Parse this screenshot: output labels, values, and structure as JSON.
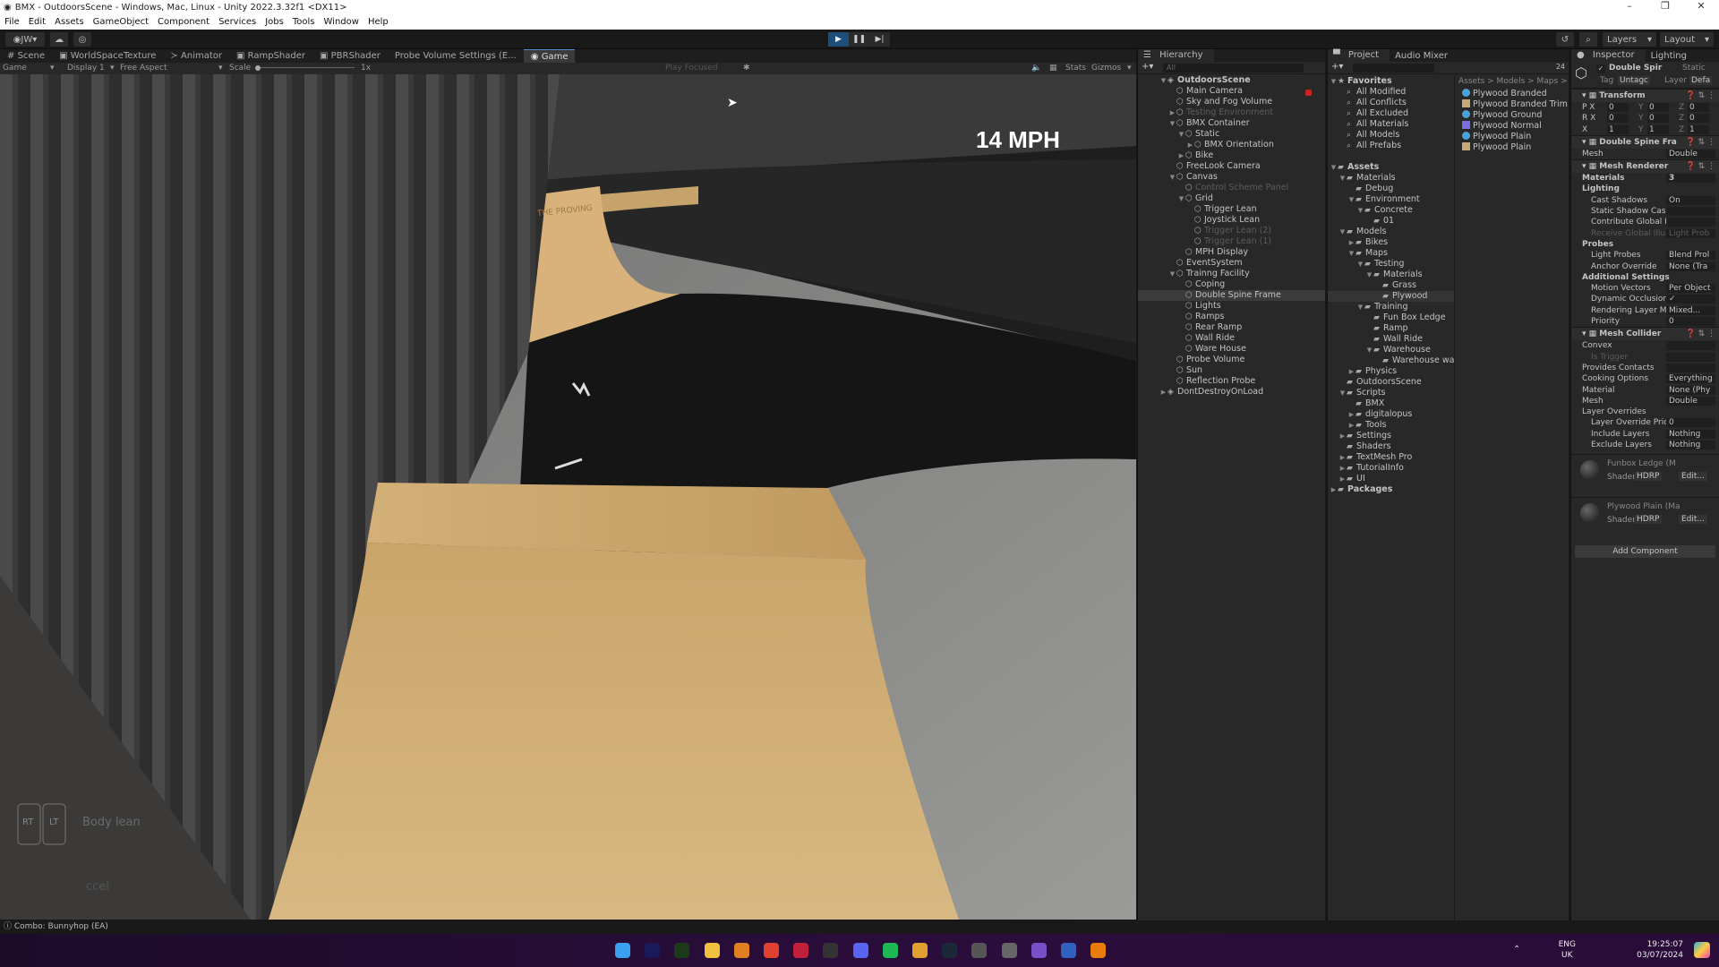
{
  "window": {
    "title": "BMX - OutdoorsScene - Windows, Mac, Linux - Unity 2022.3.32f1 <DX11>"
  },
  "menu": [
    "File",
    "Edit",
    "Assets",
    "GameObject",
    "Component",
    "Services",
    "Jobs",
    "Tools",
    "Window",
    "Help"
  ],
  "toolbar": {
    "account": "JW",
    "layers": "Layers",
    "layout": "Layout"
  },
  "tabs": [
    {
      "label": "Scene"
    },
    {
      "label": "WorldSpaceTexture"
    },
    {
      "label": "Animator"
    },
    {
      "label": "RampShader"
    },
    {
      "label": "PBRShader"
    },
    {
      "label": "Probe Volume Settings (E..."
    },
    {
      "label": "Game",
      "active": true
    }
  ],
  "gamebar": {
    "mode": "Game",
    "display": "Display 1",
    "aspect": "Free Aspect",
    "scale_label": "Scale",
    "scale_value": "1x",
    "play_focused": "Play Focused",
    "stats": "Stats",
    "gizmos": "Gizmos"
  },
  "game": {
    "speed": "14 MPH",
    "hint_rt": "RT",
    "hint_lt": "LT",
    "hint_text": "Body lean",
    "hint_text2": "ccel",
    "ramp_brand": "THE PROVING"
  },
  "hierarchy": {
    "title": "Hierarchy",
    "search": "All",
    "items": [
      {
        "label": "OutdoorsScene",
        "depth": 0,
        "arrow": "down",
        "icon": "scene",
        "bold": true
      },
      {
        "label": "Main Camera",
        "depth": 1
      },
      {
        "label": "Sky and Fog Volume",
        "depth": 1
      },
      {
        "label": "Testing Environment",
        "depth": 1,
        "arrow": "right",
        "dim": true
      },
      {
        "label": "BMX Container",
        "depth": 1,
        "arrow": "down"
      },
      {
        "label": "Static",
        "depth": 2,
        "arrow": "down"
      },
      {
        "label": "BMX Orientation",
        "depth": 3,
        "arrow": "right"
      },
      {
        "label": "Bike",
        "depth": 2,
        "arrow": "right"
      },
      {
        "label": "FreeLook Camera",
        "depth": 1
      },
      {
        "label": "Canvas",
        "depth": 1,
        "arrow": "down"
      },
      {
        "label": "Control Scheme Panel",
        "depth": 2,
        "dim": true
      },
      {
        "label": "Grid",
        "depth": 2,
        "arrow": "down"
      },
      {
        "label": "Trigger Lean",
        "depth": 3
      },
      {
        "label": "Joystick Lean",
        "depth": 3
      },
      {
        "label": "Trigger Lean (2)",
        "depth": 3,
        "dim": true
      },
      {
        "label": "Trigger Lean (1)",
        "depth": 3,
        "dim": true
      },
      {
        "label": "MPH Display",
        "depth": 2
      },
      {
        "label": "EventSystem",
        "depth": 1
      },
      {
        "label": "Trainng Facility",
        "depth": 1,
        "arrow": "down"
      },
      {
        "label": "Coping",
        "depth": 2
      },
      {
        "label": "Double Spine Frame",
        "depth": 2,
        "selected": true
      },
      {
        "label": "Lights",
        "depth": 2
      },
      {
        "label": "Ramps",
        "depth": 2
      },
      {
        "label": "Rear Ramp",
        "depth": 2
      },
      {
        "label": "Wall Ride",
        "depth": 2
      },
      {
        "label": "Ware House",
        "depth": 2
      },
      {
        "label": "Probe Volume",
        "depth": 1
      },
      {
        "label": "Sun",
        "depth": 1
      },
      {
        "label": "Reflection Probe",
        "depth": 1
      },
      {
        "label": "DontDestroyOnLoad",
        "depth": 0,
        "arrow": "right",
        "icon": "scene"
      }
    ]
  },
  "project": {
    "title": "Project",
    "tab2": "Audio Mixer",
    "count": "24",
    "breadcrumb": "Assets > Models > Maps > T",
    "tree": [
      {
        "label": "Favorites",
        "depth": 0,
        "arrow": "down",
        "icon": "star",
        "bold": true
      },
      {
        "label": "All Modified",
        "depth": 1,
        "icon": "search"
      },
      {
        "label": "All Conflicts",
        "depth": 1,
        "icon": "search"
      },
      {
        "label": "All Excluded",
        "depth": 1,
        "icon": "search"
      },
      {
        "label": "All Materials",
        "depth": 1,
        "icon": "search"
      },
      {
        "label": "All Models",
        "depth": 1,
        "icon": "search"
      },
      {
        "label": "All Prefabs",
        "depth": 1,
        "icon": "search"
      },
      {
        "label": "",
        "depth": 0,
        "icon": "none"
      },
      {
        "label": "Assets",
        "depth": 0,
        "arrow": "down",
        "icon": "folder",
        "bold": true
      },
      {
        "label": "Materials",
        "depth": 1,
        "arrow": "down",
        "icon": "folder"
      },
      {
        "label": "Debug",
        "depth": 2,
        "icon": "folder"
      },
      {
        "label": "Environment",
        "depth": 2,
        "arrow": "down",
        "icon": "folder"
      },
      {
        "label": "Concrete",
        "depth": 3,
        "arrow": "down",
        "icon": "folder"
      },
      {
        "label": "01",
        "depth": 4,
        "icon": "folder"
      },
      {
        "label": "Models",
        "depth": 1,
        "arrow": "down",
        "icon": "folder"
      },
      {
        "label": "Bikes",
        "depth": 2,
        "arrow": "right",
        "icon": "folder"
      },
      {
        "label": "Maps",
        "depth": 2,
        "arrow": "down",
        "icon": "folder"
      },
      {
        "label": "Testing",
        "depth": 3,
        "arrow": "down",
        "icon": "folder"
      },
      {
        "label": "Materials",
        "depth": 4,
        "arrow": "down",
        "icon": "folder"
      },
      {
        "label": "Grass",
        "depth": 5,
        "icon": "folder"
      },
      {
        "label": "Plywood",
        "depth": 5,
        "icon": "folder",
        "selected": true
      },
      {
        "label": "Training",
        "depth": 3,
        "arrow": "down",
        "icon": "folder"
      },
      {
        "label": "Fun Box Ledge",
        "depth": 4,
        "icon": "folder"
      },
      {
        "label": "Ramp",
        "depth": 4,
        "icon": "folder"
      },
      {
        "label": "Wall Ride",
        "depth": 4,
        "icon": "folder"
      },
      {
        "label": "Warehouse",
        "depth": 4,
        "arrow": "down",
        "icon": "folder"
      },
      {
        "label": "Warehouse wa",
        "depth": 5,
        "icon": "folder"
      },
      {
        "label": "Physics",
        "depth": 2,
        "arrow": "right",
        "icon": "folder"
      },
      {
        "label": "OutdoorsScene",
        "depth": 1,
        "icon": "folder"
      },
      {
        "label": "Scripts",
        "depth": 1,
        "arrow": "down",
        "icon": "folder"
      },
      {
        "label": "BMX",
        "depth": 2,
        "icon": "folder"
      },
      {
        "label": "digitalopus",
        "depth": 2,
        "arrow": "right",
        "icon": "folder"
      },
      {
        "label": "Tools",
        "depth": 2,
        "arrow": "right",
        "icon": "folder"
      },
      {
        "label": "Settings",
        "depth": 1,
        "arrow": "right",
        "icon": "folder"
      },
      {
        "label": "Shaders",
        "depth": 1,
        "icon": "folder"
      },
      {
        "label": "TextMesh Pro",
        "depth": 1,
        "arrow": "right",
        "icon": "folder"
      },
      {
        "label": "TutorialInfo",
        "depth": 1,
        "arrow": "right",
        "icon": "folder"
      },
      {
        "label": "UI",
        "depth": 1,
        "arrow": "right",
        "icon": "folder"
      },
      {
        "label": "Packages",
        "depth": 0,
        "arrow": "right",
        "icon": "folder",
        "bold": true
      }
    ],
    "files": [
      {
        "label": "Plywood Branded",
        "type": "material",
        "color": "#4aa3d8"
      },
      {
        "label": "Plywood Branded Trim S",
        "type": "texture",
        "color": "#c8a878"
      },
      {
        "label": "Plywood Ground",
        "type": "material",
        "color": "#4aa3d8"
      },
      {
        "label": "Plywood Normal",
        "type": "texture",
        "color": "#7a6ee0"
      },
      {
        "label": "Plywood Plain",
        "type": "material",
        "color": "#4aa3d8"
      },
      {
        "label": "Plywood Plain",
        "type": "texture",
        "color": "#c8a878"
      }
    ]
  },
  "inspector": {
    "title": "Inspector",
    "tab2": "Lighting",
    "object_name": "Double Spir",
    "static": "Static",
    "tag_label": "Tag",
    "tag": "Untagc",
    "layer_label": "Layer",
    "layer": "Defa",
    "rows": [
      {
        "kind": "hdr",
        "label": "Transform"
      },
      {
        "label": "P X",
        "value": "0",
        "y": "0",
        "z": "0",
        "kind": "vec"
      },
      {
        "label": "R X",
        "value": "0",
        "y": "0",
        "z": "0",
        "kind": "vec"
      },
      {
        "label": "X",
        "value": "1",
        "y": "1",
        "z": "1",
        "kind": "vec"
      },
      {
        "kind": "hdr",
        "label": "Double Spine Fra"
      },
      {
        "label": "Mesh",
        "value": "Double"
      },
      {
        "kind": "hdr",
        "label": "Mesh Renderer"
      },
      {
        "label": "Materials",
        "value": "3",
        "bold": true
      },
      {
        "label": "Lighting",
        "bold": true
      },
      {
        "label": "Cast Shadows",
        "value": "On",
        "sub": true
      },
      {
        "label": "Static Shadow Cas",
        "value": "",
        "sub": true
      },
      {
        "label": "Contribute Global I",
        "value": "",
        "sub": true
      },
      {
        "label": "Receive Global Illu",
        "value": "Light Prob",
        "sub": true,
        "dim": true
      },
      {
        "label": "Probes",
        "bold": true
      },
      {
        "label": "Light Probes",
        "value": "Blend Prol",
        "sub": true
      },
      {
        "label": "Anchor Override",
        "value": "None (Tra",
        "sub": true
      },
      {
        "label": "Additional Settings",
        "bold": true
      },
      {
        "label": "Motion Vectors",
        "value": "Per Object",
        "sub": true
      },
      {
        "label": "Dynamic Occlusion",
        "value": "✓",
        "sub": true
      },
      {
        "label": "Rendering Layer M",
        "value": "Mixed...",
        "sub": true
      },
      {
        "label": "Priority",
        "value": "0",
        "sub": true
      },
      {
        "kind": "hdr",
        "label": "Mesh Collider"
      },
      {
        "label": "Convex",
        "value": ""
      },
      {
        "label": "Is Trigger",
        "value": "",
        "sub": true,
        "dim": true
      },
      {
        "label": "Provides Contacts",
        "value": ""
      },
      {
        "label": "Cooking Options",
        "value": "Everything"
      },
      {
        "label": "Material",
        "value": "None (Phy"
      },
      {
        "label": "Mesh",
        "value": "Double"
      },
      {
        "label": "Layer Overrides",
        "bold": false
      },
      {
        "label": "Layer Override Pric",
        "value": "0",
        "sub": true
      },
      {
        "label": "Include Layers",
        "value": "Nothing",
        "sub": true
      },
      {
        "label": "Exclude Layers",
        "value": "Nothing",
        "sub": true
      }
    ],
    "materials": [
      {
        "name": "Funbox Ledge (M",
        "shader_label": "Shader",
        "shader": "HDRP",
        "edit": "Edit..."
      },
      {
        "name": "Plywood Plain (Ma",
        "shader_label": "Shader",
        "shader": "HDRP",
        "edit": "Edit..."
      }
    ],
    "add_component": "Add Component"
  },
  "status": {
    "text": "Combo: Bunnyhop (EA)"
  },
  "taskbar": {
    "icons": [
      {
        "name": "windows-start",
        "color": "#3aa0f0"
      },
      {
        "name": "premiere",
        "color": "#1a1a5a"
      },
      {
        "name": "pycharm",
        "color": "#1a3a1a"
      },
      {
        "name": "file-explorer",
        "color": "#f0c040"
      },
      {
        "name": "firefox",
        "color": "#e08020"
      },
      {
        "name": "chrome",
        "color": "#e04030"
      },
      {
        "name": "opera",
        "color": "#c0203a"
      },
      {
        "name": "media",
        "color": "#333"
      },
      {
        "name": "discord",
        "color": "#5865f2"
      },
      {
        "name": "spotify",
        "color": "#1db954"
      },
      {
        "name": "chrome-alt",
        "color": "#e0a030"
      },
      {
        "name": "steam",
        "color": "#1b2838"
      },
      {
        "name": "unity-hub",
        "color": "#555"
      },
      {
        "name": "unity",
        "color": "#666"
      },
      {
        "name": "visual-studio",
        "color": "#7b4fc8"
      },
      {
        "name": "app",
        "color": "#3060c0"
      },
      {
        "name": "blender",
        "color": "#e87d0d"
      }
    ],
    "lang": "ENG",
    "region": "UK",
    "time": "19:25:07",
    "date": "03/07/2024"
  }
}
